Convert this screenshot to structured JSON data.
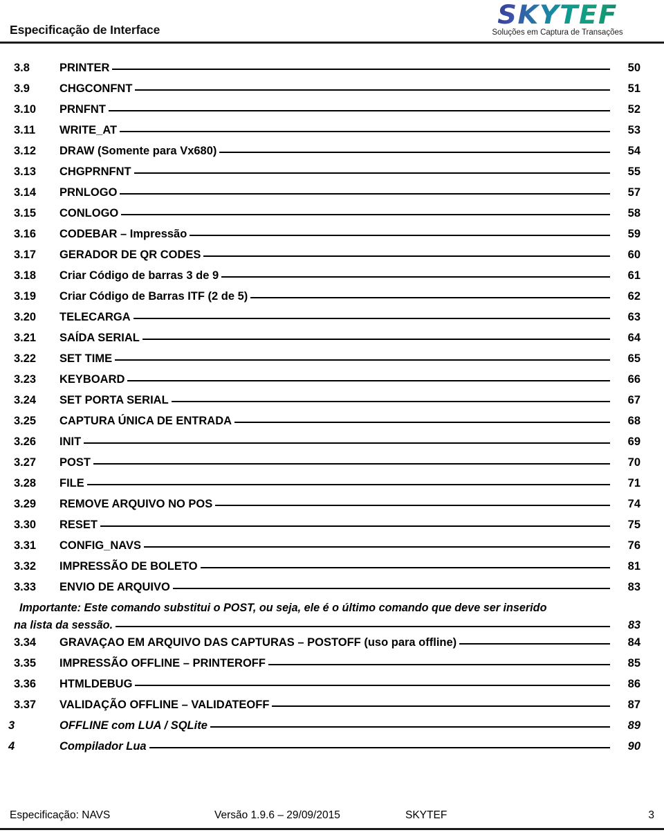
{
  "header": {
    "title": "Especificação de Interface",
    "logo": {
      "wordmark": "SKYTEF",
      "tagline": "Soluções em Captura de Transações",
      "gradient_start": "#2b3990",
      "gradient_end": "#0d5f58"
    }
  },
  "toc": {
    "entries": [
      {
        "num": "3.8",
        "label": "PRINTER",
        "page": "50",
        "level": 2
      },
      {
        "num": "3.9",
        "label": "CHGCONFNT",
        "page": "51",
        "level": 2
      },
      {
        "num": "3.10",
        "label": "PRNFNT",
        "page": "52",
        "level": 2
      },
      {
        "num": "3.11",
        "label": "WRITE_AT",
        "page": "53",
        "level": 2
      },
      {
        "num": "3.12",
        "label": "DRAW (Somente para Vx680)",
        "page": "54",
        "level": 2
      },
      {
        "num": "3.13",
        "label": "CHGPRNFNT",
        "page": "55",
        "level": 2
      },
      {
        "num": "3.14",
        "label": "PRNLOGO",
        "page": "57",
        "level": 2
      },
      {
        "num": "3.15",
        "label": "CONLOGO",
        "page": "58",
        "level": 2
      },
      {
        "num": "3.16",
        "label": "CODEBAR – Impressão",
        "page": "59",
        "level": 2
      },
      {
        "num": "3.17",
        "label": "GERADOR DE QR CODES",
        "page": "60",
        "level": 2
      },
      {
        "num": "3.18",
        "label": "Criar Código de barras 3 de 9",
        "page": "61",
        "level": 2
      },
      {
        "num": "3.19",
        "label": "Criar Código de Barras ITF (2 de 5)",
        "page": "62",
        "level": 2
      },
      {
        "num": "3.20",
        "label": "TELECARGA",
        "page": "63",
        "level": 2
      },
      {
        "num": "3.21",
        "label": "SAÍDA SERIAL",
        "page": "64",
        "level": 2
      },
      {
        "num": "3.22",
        "label": "SET TIME",
        "page": "65",
        "level": 2
      },
      {
        "num": "3.23",
        "label": "KEYBOARD",
        "page": "66",
        "level": 2
      },
      {
        "num": "3.24",
        "label": "SET PORTA SERIAL",
        "page": "67",
        "level": 2
      },
      {
        "num": "3.25",
        "label": "CAPTURA ÚNICA DE ENTRADA",
        "page": "68",
        "level": 2
      },
      {
        "num": "3.26",
        "label": "INIT",
        "page": "69",
        "level": 2
      },
      {
        "num": "3.27",
        "label": "POST",
        "page": "70",
        "level": 2
      },
      {
        "num": "3.28",
        "label": "FILE",
        "page": "71",
        "level": 2
      },
      {
        "num": "3.29",
        "label": "REMOVE ARQUIVO NO POS",
        "page": "74",
        "level": 2
      },
      {
        "num": "3.30",
        "label": "RESET",
        "page": "75",
        "level": 2
      },
      {
        "num": "3.31",
        "label": "CONFIG_NAVS",
        "page": "76",
        "level": 2
      },
      {
        "num": "3.32",
        "label": "IMPRESSÃO DE BOLETO",
        "page": "81",
        "level": 2
      },
      {
        "num": "3.33",
        "label": "ENVIO DE ARQUIVO",
        "page": "83",
        "level": 2
      }
    ],
    "note": {
      "line1": "Importante: Este comando substitui o POST, ou seja, ele é o último comando que deve ser inserido",
      "line2": "na lista da sessão.",
      "page": "83"
    },
    "entries_after_note": [
      {
        "num": "3.34",
        "label": "GRAVAÇAO EM ARQUIVO DAS CAPTURAS – POSTOFF (uso para offline)",
        "page": "84",
        "level": 2
      },
      {
        "num": "3.35",
        "label": "IMPRESSÃO OFFLINE – PRINTEROFF",
        "page": "85",
        "level": 2
      },
      {
        "num": "3.36",
        "label": "HTMLDEBUG",
        "page": "86",
        "level": 2
      },
      {
        "num": "3.37",
        "label": "VALIDAÇÃO OFFLINE – VALIDATEOFF",
        "page": "87",
        "level": 2
      },
      {
        "num": "3",
        "label": "OFFLINE com LUA / SQLite",
        "page": "89",
        "level": 1
      },
      {
        "num": "4",
        "label": "Compilador Lua",
        "page": "90",
        "level": 1
      }
    ]
  },
  "footer": {
    "spec": "Especificação: NAVS",
    "version": "Versão 1.9.6 – 29/09/2015",
    "company": "SKYTEF",
    "page_number": "3"
  }
}
